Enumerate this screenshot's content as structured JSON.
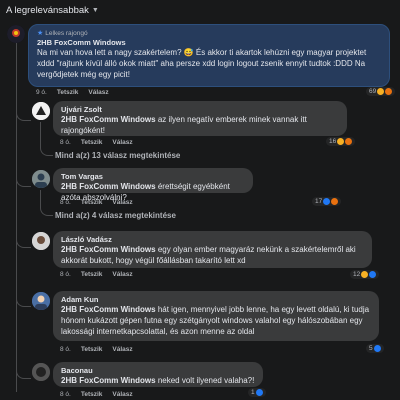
{
  "sort": {
    "label": "A legrelevánsabbak"
  },
  "comments": [
    {
      "author": "2HB FoxComm Windows",
      "badge": "Lelkes rajongó",
      "text": "Na mi van hova lett a nagy szakértelem? 😅 És akkor ti akartok lehúzni egy magyar projektet xddd \"rajtunk kívül álló okok miatt\" aha persze xdd login logout zsenik ennyit tudtok :DDD Na vergődjetek még egy picit!",
      "time": "9 ó.",
      "like": "Tetszik",
      "reply": "Válasz",
      "reactions": "69"
    },
    {
      "author": "Ujvári Zsolt",
      "mention": "2HB FoxComm Windows",
      "text": " az ilyen negatív emberek minek vannak itt rajongóként!",
      "time": "8 ó.",
      "like": "Tetszik",
      "reply": "Válasz",
      "reactions": "16",
      "replies": "Mind a(z) 13 válasz megtekintése"
    },
    {
      "author": "Tom Vargas",
      "mention": "2HB FoxComm Windows",
      "text": " érettségit egyébként azóta abszolválni?",
      "time": "8 ó.",
      "like": "Tetszik",
      "reply": "Válasz",
      "reactions": "17",
      "replies": "Mind a(z) 4 válasz megtekintése"
    },
    {
      "author": "László Vadász",
      "mention": "2HB FoxComm Windows",
      "text": " egy olyan ember magyaráz nekünk a szakértelemről aki akkorát bukott, hogy végül főállásban takarító lett xd",
      "time": "8 ó.",
      "like": "Tetszik",
      "reply": "Válasz",
      "reactions": "12"
    },
    {
      "author": "Adam Kun",
      "mention": "2HB FoxComm Windows",
      "text": " hát igen, mennyivel jobb lenne, ha egy levett oldalú, ki tudja hónom kukázott gépen futna egy szétgányolt windows valahol egy hálószobában egy lakossági internetkapcsolattal, és azon menne az oldal",
      "time": "8 ó.",
      "like": "Tetszik",
      "reply": "Válasz",
      "reactions": "5"
    },
    {
      "author": "Baconau",
      "mention": "2HB FoxComm Windows",
      "text": " neked volt ilyened valaha?!",
      "time": "8 ó.",
      "like": "Tetszik",
      "reply": "Válasz",
      "reactions": "1"
    }
  ]
}
